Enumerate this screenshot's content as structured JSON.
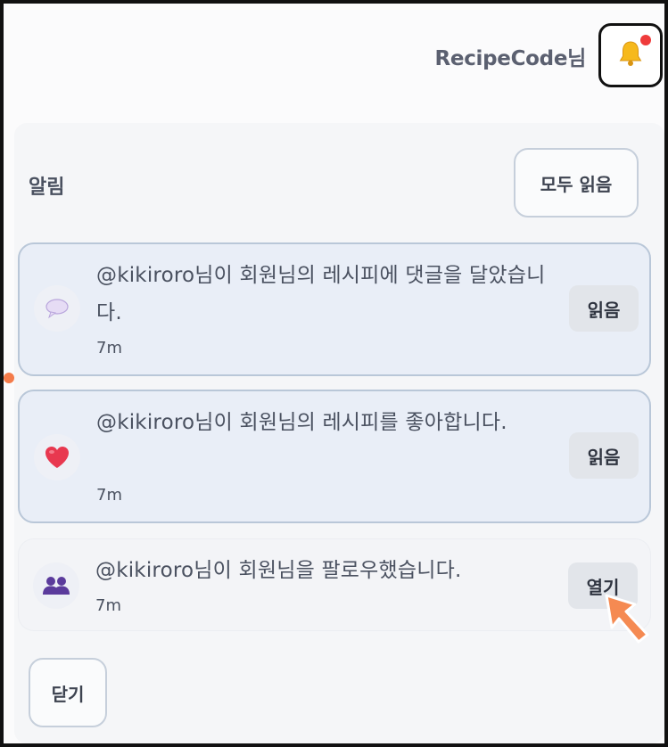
{
  "header": {
    "username": "RecipeCode님",
    "bell_icon": "bell-icon",
    "unread_indicator_color": "#ef3b3b"
  },
  "panel": {
    "title": "알림",
    "read_all_label": "모두 읽음",
    "close_label": "닫기"
  },
  "notifications": [
    {
      "icon": "speech-bubble-icon",
      "message": "@kikiroro님이 회원님의 레시피에 댓글을 달았습니다.",
      "time": "7m",
      "action_label": "읽음",
      "state": "unread"
    },
    {
      "icon": "heart-icon",
      "message": "@kikiroro님이 회원님의 레시피를 좋아합니다.",
      "time": "7m",
      "action_label": "읽음",
      "state": "unread"
    },
    {
      "icon": "users-icon",
      "message": "@kikiroro님이 회원님을 팔로우했습니다.",
      "time": "7m",
      "action_label": "열기",
      "state": "read"
    }
  ],
  "colors": {
    "accent_orange": "#f47b4a",
    "unread_bg": "#e9eef7",
    "unread_border": "#b9c7d8"
  }
}
